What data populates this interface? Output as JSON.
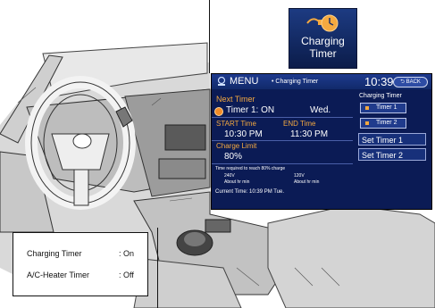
{
  "icon": {
    "label_line1": "Charging",
    "label_line2": "Timer",
    "name": "charging-timer-icon"
  },
  "screen": {
    "header": {
      "menu_label": "MENU",
      "breadcrumb": "• Charging Timer",
      "clock": "10:39",
      "back_label": "BACK"
    },
    "next_timer": {
      "heading": "Next Timer",
      "timer_text": "Timer 1: ON",
      "day": "Wed."
    },
    "start_time": {
      "label": "START Time",
      "value": "10:30 PM"
    },
    "end_time": {
      "label": "END Time",
      "value": "11:30 PM"
    },
    "charge_limit": {
      "label": "Charge Limit",
      "value": "80%"
    },
    "time_required": {
      "label": "Time required to reach 80% charge",
      "v240": "240V",
      "v240_value": "About hr min",
      "v120": "120V",
      "v120_value": "About hr min"
    },
    "current_time": "Current Time: 10:39 PM Tue.",
    "right_panel": {
      "title": "Charging Timer",
      "timer1": "Timer 1",
      "timer2": "Timer 2",
      "set_timer1": "Set Timer 1",
      "set_timer2": "Set Timer 2"
    }
  },
  "status_box": {
    "rows": [
      {
        "label": "Charging Timer",
        "value": ": On"
      },
      {
        "label": "A/C-Heater Timer",
        "value": ": Off"
      }
    ]
  },
  "colors": {
    "screen_bg": "#0b1b55",
    "accent_orange": "#f4a940"
  }
}
